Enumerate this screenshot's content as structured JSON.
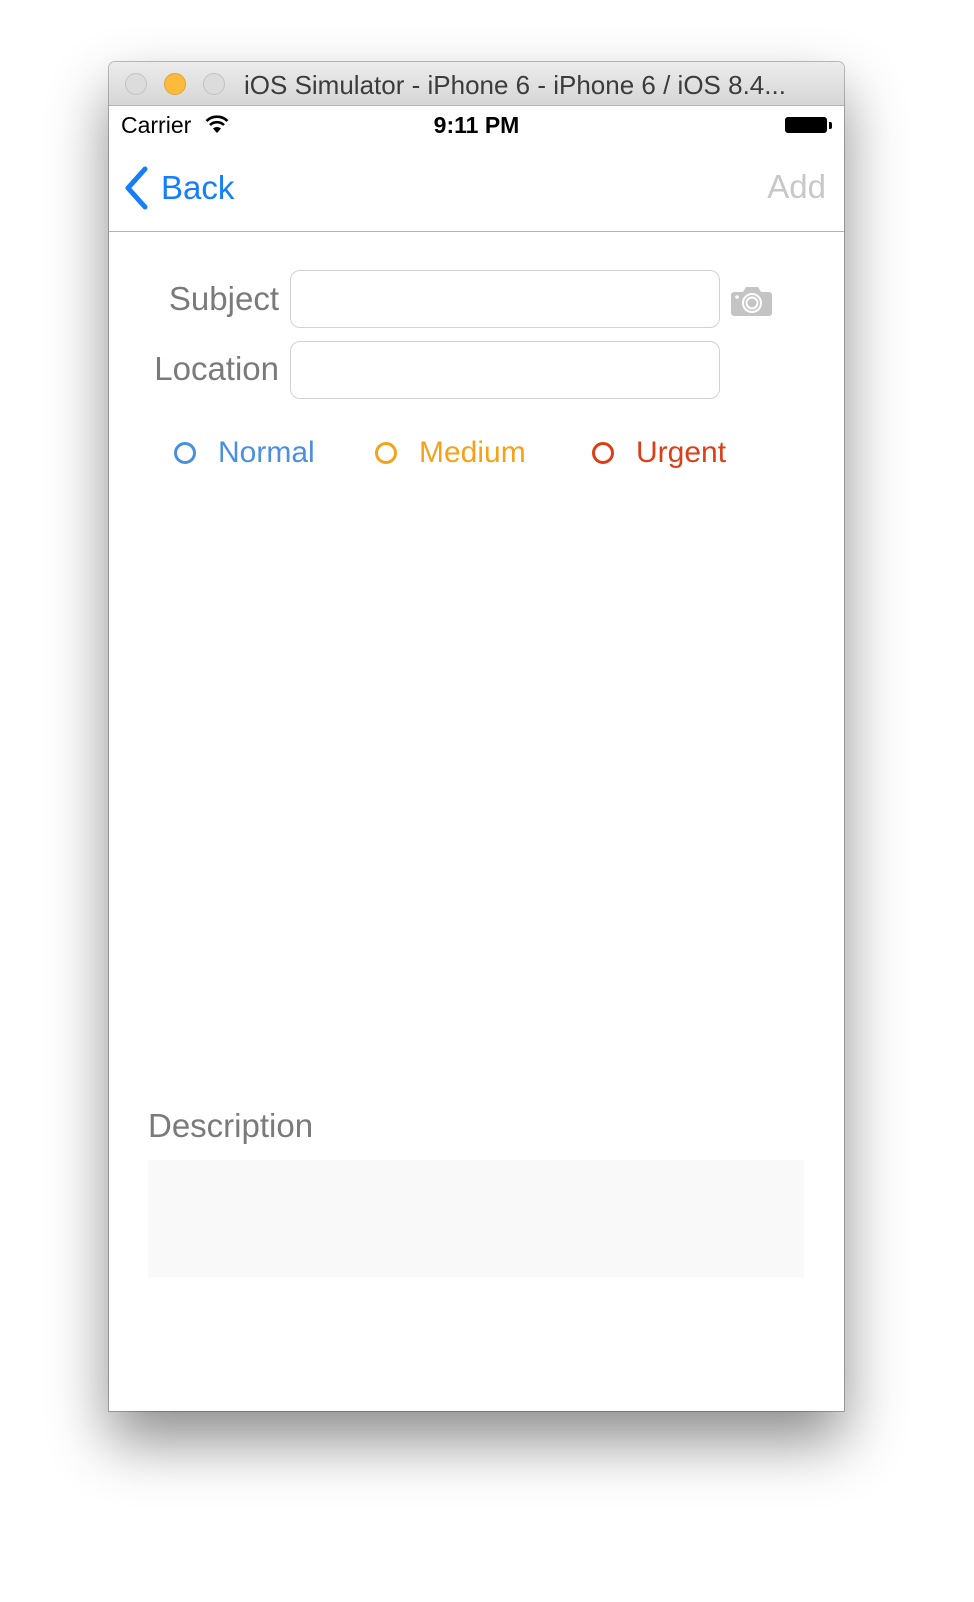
{
  "window": {
    "title": "iOS Simulator - iPhone 6 - iPhone 6 / iOS 8.4...",
    "traffic_lights": [
      "close",
      "minimize",
      "zoom"
    ]
  },
  "status_bar": {
    "carrier": "Carrier",
    "time": "9:11 PM",
    "wifi_icon": "wifi-icon",
    "battery_icon": "battery-full-icon"
  },
  "navbar": {
    "back_label": "Back",
    "add_label": "Add",
    "back_color": "#147efb",
    "add_color": "#c8c8c8"
  },
  "form": {
    "subject_label": "Subject",
    "subject_value": "",
    "location_label": "Location",
    "location_value": "",
    "camera_icon": "camera-icon"
  },
  "priority": {
    "options": [
      {
        "label": "Normal",
        "color": "#4a8fe0",
        "selected": false
      },
      {
        "label": "Medium",
        "color": "#f5a21b",
        "selected": false
      },
      {
        "label": "Urgent",
        "color": "#d9401a",
        "selected": false
      }
    ]
  },
  "description": {
    "label": "Description",
    "value": ""
  }
}
